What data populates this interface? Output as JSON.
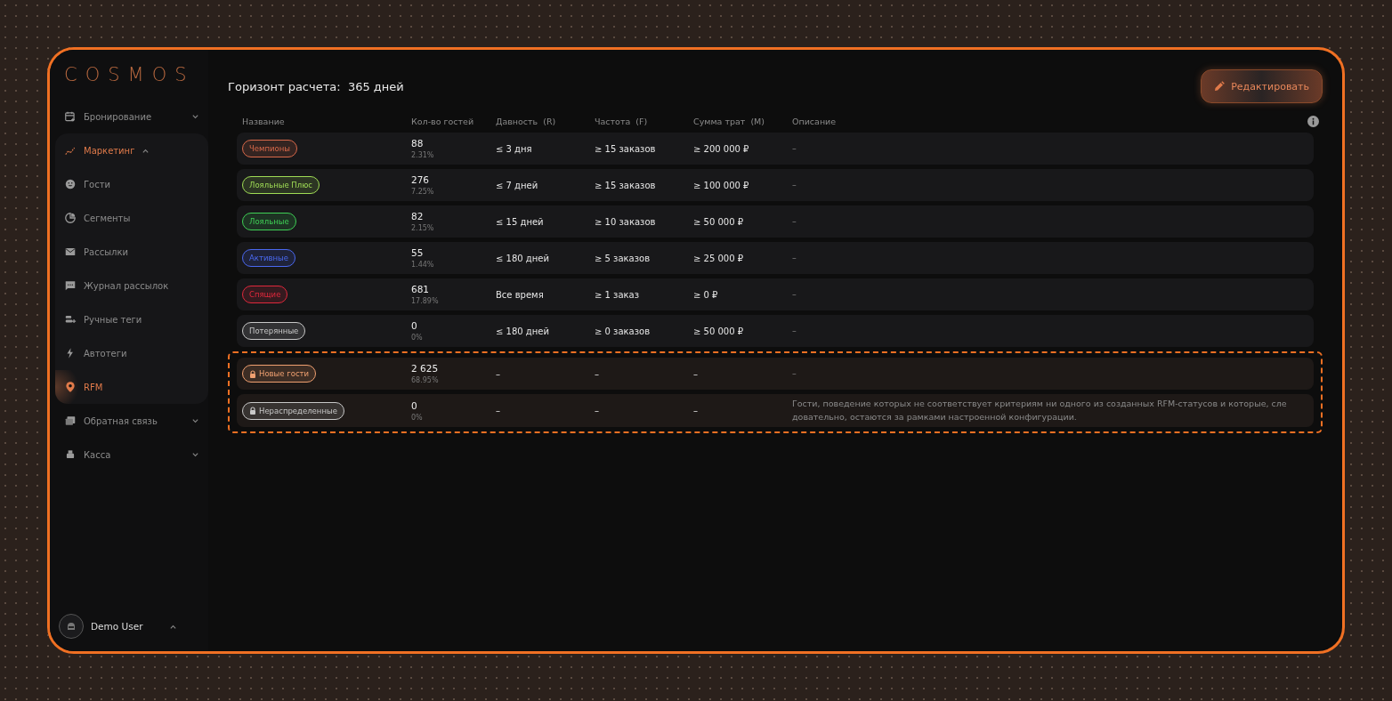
{
  "sidebar": {
    "logo": "COSMOS",
    "items": [
      {
        "label": "Бронирование",
        "expanded": false,
        "selected": false
      },
      {
        "label": "Маркетинг",
        "expanded": true,
        "selected": true,
        "children": [
          {
            "label": "Гости",
            "selected": false
          },
          {
            "label": "Сегменты",
            "selected": false
          },
          {
            "label": "Рассылки",
            "selected": false
          },
          {
            "label": "Журнал рассылок",
            "selected": false
          },
          {
            "label": "Ручные теги",
            "selected": false
          },
          {
            "label": "Автотеги",
            "selected": false
          },
          {
            "label": "RFM",
            "selected": true
          }
        ]
      },
      {
        "label": "Обратная связь",
        "expanded": false,
        "selected": false
      },
      {
        "label": "Касса",
        "expanded": false,
        "selected": false
      }
    ],
    "user": {
      "name": "Demo User",
      "expanded": true
    }
  },
  "header": {
    "title": "Горизонт расчета:  365 дней",
    "edit_button": "Редактировать"
  },
  "table": {
    "columns": [
      "Название",
      "Кол-во гостей",
      "Давность  (R)",
      "Частота  (F)",
      "Сумма трат  (M)",
      "Описание"
    ],
    "rows": [
      {
        "tag": "Чемпионы",
        "color": "#d9694a",
        "locked": false,
        "count": "88",
        "share": "2.31%",
        "recency": "≤ 3 дня",
        "frequency": "≥ 15 заказов",
        "monetary": "≥ 200 000 ₽",
        "description": "–"
      },
      {
        "tag": "Лояльные Плюс",
        "color": "#9fdc55",
        "locked": false,
        "count": "276",
        "share": "7.25%",
        "recency": "≤ 7 дней",
        "frequency": "≥ 15 заказов",
        "monetary": "≥ 100 000 ₽",
        "description": "–"
      },
      {
        "tag": "Лояльные",
        "color": "#3fcf55",
        "locked": false,
        "count": "82",
        "share": "2.15%",
        "recency": "≤ 15 дней",
        "frequency": "≥ 10 заказов",
        "monetary": "≥ 50 000 ₽",
        "description": "–"
      },
      {
        "tag": "Активные",
        "color": "#4a68f0",
        "locked": false,
        "count": "55",
        "share": "1.44%",
        "recency": "≤ 180 дней",
        "frequency": "≥ 5 заказов",
        "monetary": "≥ 25 000 ₽",
        "description": "–"
      },
      {
        "tag": "Спящие",
        "color": "#e0283c",
        "locked": false,
        "count": "681",
        "share": "17.89%",
        "recency": "Все время",
        "frequency": "≥ 1 заказ",
        "monetary": "≥ 0 ₽",
        "description": "–"
      },
      {
        "tag": "Потерянные",
        "color": "#c8c8c8",
        "locked": false,
        "count": "0",
        "share": "0%",
        "recency": "≤ 180 дней",
        "frequency": "≥ 0 заказов",
        "monetary": "≥ 50 000 ₽",
        "description": "–"
      }
    ],
    "system_rows": [
      {
        "tag": "Новые гости",
        "color": "#f0a070",
        "locked": true,
        "count": "2 625",
        "share": "68.95%",
        "recency": "–",
        "frequency": "–",
        "monetary": "–",
        "description": "–"
      },
      {
        "tag": "Нераспределенные",
        "color": "#c8c8c8",
        "locked": true,
        "count": "0",
        "share": "0%",
        "recency": "–",
        "frequency": "–",
        "monetary": "–",
        "description": "Гости, поведение которых не соответствует критериям ни одного из созданных RFM-статусов и которые, следовательно, остаются за рамками настроенной конфигурации."
      }
    ]
  }
}
